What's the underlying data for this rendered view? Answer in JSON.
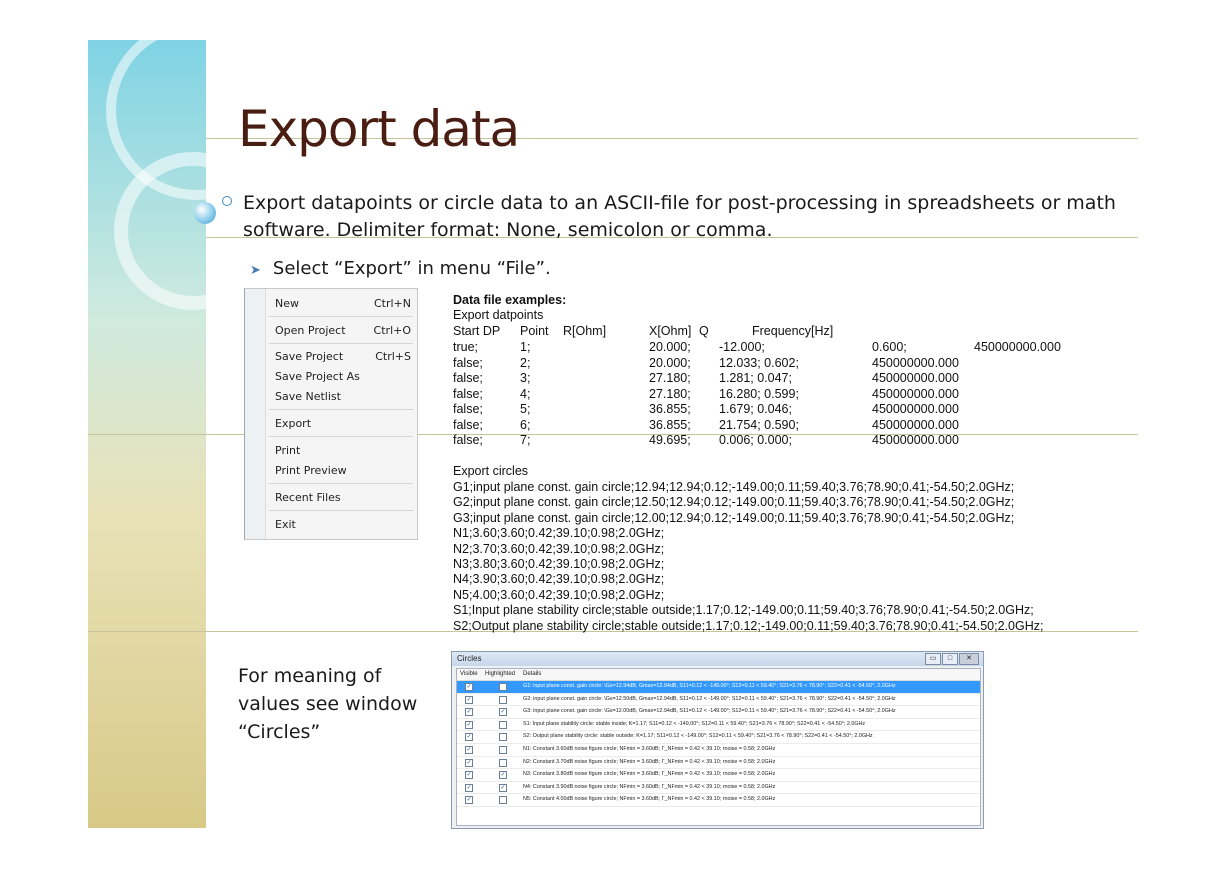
{
  "slide": {
    "title": "Export data",
    "intro": "Export datapoints or circle data to an ASCII-file for post-processing in spreadsheets or math software. Delimiter format: None, semicolon or comma.",
    "sub_bullet": "Select “Export” in menu “File”.",
    "meaning_text": "For meaning of values see window “Circles”",
    "colors": {
      "title": "#4a1d12",
      "accent": "#3a9bd0",
      "selection": "#3399ff"
    }
  },
  "file_menu": {
    "items": [
      {
        "label": "New",
        "shortcut": "Ctrl+N"
      },
      {
        "label": "Open Project",
        "shortcut": "Ctrl+O"
      },
      {
        "label": "Save Project",
        "shortcut": "Ctrl+S"
      },
      {
        "label": "Save Project As",
        "shortcut": ""
      },
      {
        "label": "Save Netlist",
        "shortcut": ""
      },
      {
        "label": "Export",
        "shortcut": ""
      },
      {
        "label": "Print",
        "shortcut": ""
      },
      {
        "label": "Print Preview",
        "shortcut": ""
      },
      {
        "label": "Recent Files",
        "shortcut": ""
      },
      {
        "label": "Exit",
        "shortcut": ""
      }
    ]
  },
  "examples": {
    "heading": "Data file examples:",
    "datapoints_title": "Export datpoints",
    "columns": [
      "Start DP",
      "Point",
      "R[Ohm]",
      "X[Ohm]",
      "Q",
      "Frequency[Hz]"
    ],
    "rows": [
      [
        "true;",
        "1;",
        "20.000;",
        "-12.000;",
        "0.600;",
        "450000000.000"
      ],
      [
        "false;",
        "2;",
        "20.000;",
        "12.033; 0.602;",
        "450000000.000",
        ""
      ],
      [
        "false;",
        "3;",
        "27.180;",
        "1.281;   0.047;",
        "450000000.000",
        ""
      ],
      [
        "false;",
        "4;",
        "27.180;",
        "16.280; 0.599;",
        "450000000.000",
        ""
      ],
      [
        "false;",
        "5;",
        "36.855;",
        "1.679;   0.046;",
        "450000000.000",
        ""
      ],
      [
        "false;",
        "6;",
        "36.855;",
        "21.754; 0.590;",
        "450000000.000",
        ""
      ],
      [
        "false;",
        "7;",
        "49.695;",
        "0.006;   0.000;",
        "450000000.000",
        ""
      ]
    ],
    "circles_title": "Export circles",
    "circle_lines": [
      "G1;input plane const. gain circle;12.94;12.94;0.12;-149.00;0.11;59.40;3.76;78.90;0.41;-54.50;2.0GHz;",
      "G2;input plane const. gain circle;12.50;12.94;0.12;-149.00;0.11;59.40;3.76;78.90;0.41;-54.50;2.0GHz;",
      "G3;input plane const. gain circle;12.00;12.94;0.12;-149.00;0.11;59.40;3.76;78.90;0.41;-54.50;2.0GHz;",
      "N1;3.60;3.60;0.42;39.10;0.98;2.0GHz;",
      "N2;3.70;3.60;0.42;39.10;0.98;2.0GHz;",
      "N3;3.80;3.60;0.42;39.10;0.98;2.0GHz;",
      "N4;3.90;3.60;0.42;39.10;0.98;2.0GHz;",
      "N5;4.00;3.60;0.42;39.10;0.98;2.0GHz;",
      "S1;Input plane stability circle;stable outside;1.17;0.12;-149.00;0.11;59.40;3.76;78.90;0.41;-54.50;2.0GHz;",
      "S2;Output plane stability circle;stable outside;1.17;0.12;-149.00;0.11;59.40;3.76;78.90;0.41;-54.50;2.0GHz;"
    ]
  },
  "circles_window": {
    "title": "Circles",
    "buttons": {
      "minimize": "▭",
      "maximize": "□",
      "close": "✕"
    },
    "columns": [
      "Visible",
      "Highlighted",
      "Details"
    ],
    "rows": [
      {
        "visible": true,
        "highlighted": false,
        "selected": true,
        "details": "G1: input plane const. gain circle: \\Gs=12.94dB, Gmax=12.94dB, S11=0.12 < -149.00°; S12=0.11 < 59.40°; S21=3.76 < 78.90°; S22=0.41 < -54.50°; 2.0GHz"
      },
      {
        "visible": true,
        "highlighted": false,
        "selected": false,
        "details": "G2: input plane const. gain circle: \\Gs=12.50dB, Gmax=12.94dB, S11=0.12 < -149.00°; S12=0.11 < 59.40°; S21=3.76 < 78.90°; S22=0.41 < -54.50°; 2.0GHz"
      },
      {
        "visible": true,
        "highlighted": true,
        "selected": false,
        "details": "G3: input plane const. gain circle: \\Gs=12.00dB, Gmax=12.94dB, S11=0.12 < -149.00°; S12=0.11 < 59.40°; S21=3.76 < 78.90°; S22=0.41 < -54.50°; 2.0GHz"
      },
      {
        "visible": true,
        "highlighted": false,
        "selected": false,
        "details": "S1: Input plane stability circle: stable inside; K=1.17; S11=0.12 < -149.00°; S12=0.11 < 59.40°; S21=3.76 < 78.90°; S22=0.41 < -54.50°; 2.0GHz"
      },
      {
        "visible": true,
        "highlighted": false,
        "selected": false,
        "details": "S2: Output plane stability circle: stable outside; K=1.17; S11=0.12 < -149.00°; S12=0.11 < 59.40°; S21=3.76 < 78.90°; S22=0.41 < -54.50°; 2.0GHz"
      },
      {
        "visible": true,
        "highlighted": false,
        "selected": false,
        "details": "N1: Constant 3.60dB noise figure circle; NFmin = 3.60dB; Γ_NFmin = 0.42 < 39.10; rnoise = 0.58; 2.0GHz"
      },
      {
        "visible": true,
        "highlighted": false,
        "selected": false,
        "details": "N2: Constant 3.70dB noise figure circle; NFmin = 3.60dB; Γ_NFmin = 0.42 < 39.10; rnoise = 0.58; 2.0GHz"
      },
      {
        "visible": true,
        "highlighted": true,
        "selected": false,
        "details": "N3: Constant 3.80dB noise figure circle; NFmin = 3.60dB; Γ_NFmin = 0.42 < 39.10; rnoise = 0.58; 2.0GHz"
      },
      {
        "visible": true,
        "highlighted": true,
        "selected": false,
        "details": "N4: Constant 3.90dB noise figure circle; NFmin = 3.60dB; Γ_NFmin = 0.42 < 39.10; rnoise = 0.58; 2.0GHz"
      },
      {
        "visible": true,
        "highlighted": false,
        "selected": false,
        "details": "N5: Constant 4.00dB noise figure circle; NFmin = 3.60dB; Γ_NFmin = 0.42 < 39.10; rnoise = 0.58; 2.0GHz"
      }
    ]
  }
}
